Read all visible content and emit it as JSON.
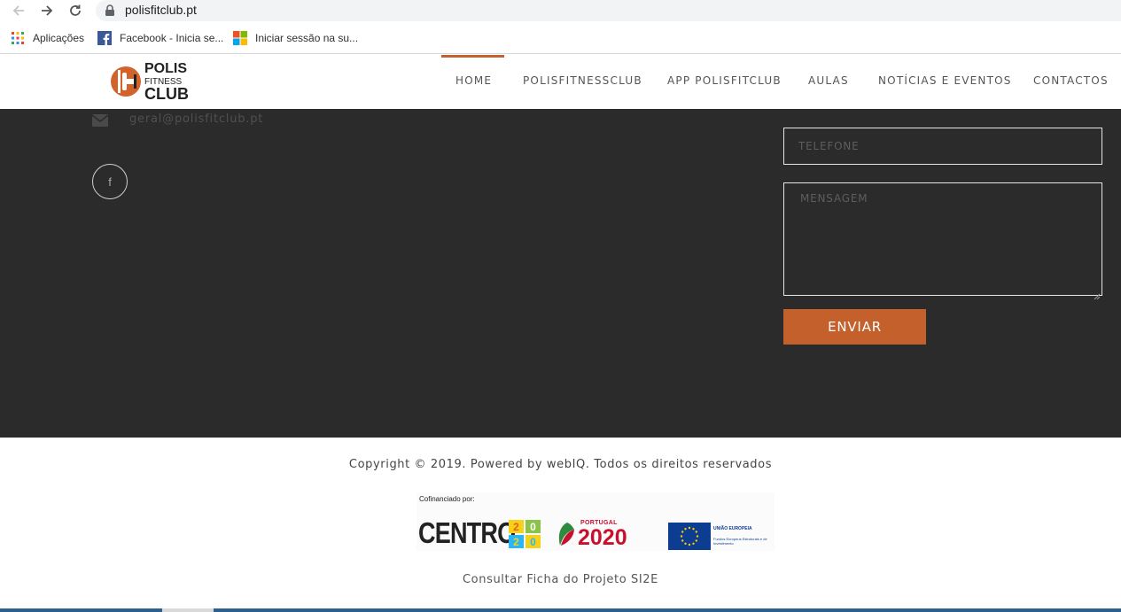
{
  "browser": {
    "url": "polisfitclub.pt",
    "bookmarks": [
      {
        "label": "Aplicações",
        "icon": "apps-grid-icon"
      },
      {
        "label": "Facebook - Inicia se...",
        "icon": "facebook-icon"
      },
      {
        "label": "Iniciar sessão na su...",
        "icon": "microsoft-icon"
      }
    ]
  },
  "site": {
    "logo": {
      "line1": "POLIS",
      "line2": "FITNESS",
      "line3": "CLUB"
    },
    "menu": {
      "home": "HOME",
      "polisfitnessclub": "POLISFITNESSCLUB",
      "app": "APP POLISFITCLUB",
      "aulas": "AULAS",
      "noticias": "NOTÍCIAS E EVENTOS",
      "contactos": "CONTACTOS"
    },
    "active_menu": "HOME",
    "accent_color": "#c3602b"
  },
  "contact": {
    "email": "geral@polisfitclub.pt",
    "facebook_glyph": "f",
    "phone_placeholder": "TELEFONE",
    "message_placeholder": "MENSAGEM",
    "send_label": "ENVIAR"
  },
  "footer": {
    "copyright": "Copyright © 2019. Powered by webIQ. Todos os direitos reservados",
    "cofinanced_label": "Cofinanciado por:",
    "centro_text": "CENTRO",
    "centro_digits": [
      "2",
      "0",
      "2",
      "0"
    ],
    "portugal_label": "PORTUGAL",
    "portugal_year": "2020",
    "eu_label": "UNIÃO EUROPEIA",
    "eu_sub": "Fundos Europeus Estruturais e de Investimento",
    "project_link": "Consultar Ficha do Projeto SI2E"
  }
}
